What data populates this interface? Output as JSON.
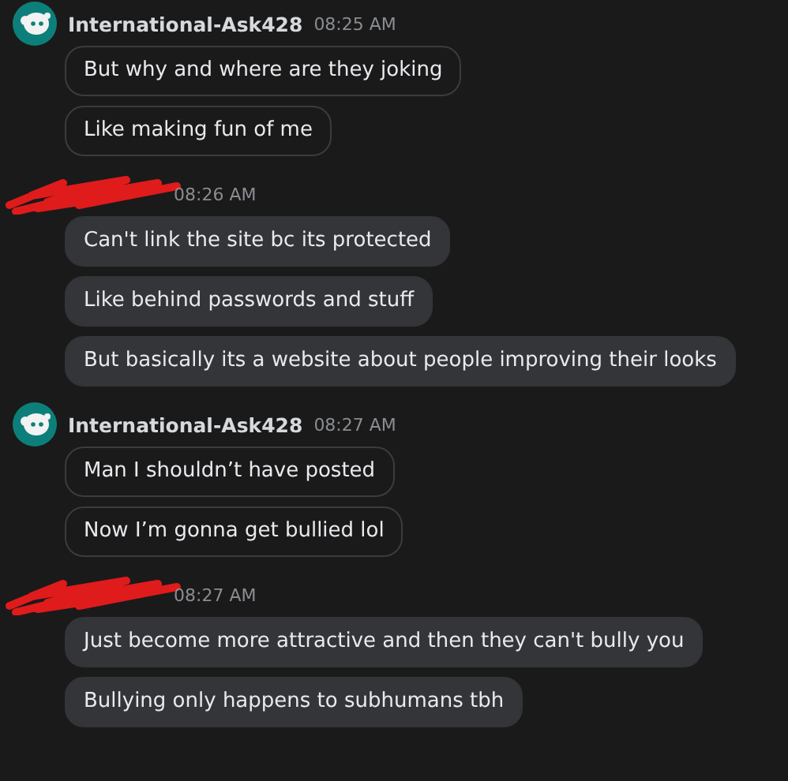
{
  "messages": [
    {
      "kind": "own",
      "author": "International-Ask428",
      "time": "08:25 AM",
      "lines": [
        "But why and where are they joking",
        "Like making fun of me"
      ]
    },
    {
      "kind": "redacted",
      "time": "08:26 AM",
      "lines": [
        "Can't link the site bc its protected",
        "Like behind passwords and stuff",
        "But basically its a website about people improving their looks"
      ]
    },
    {
      "kind": "own",
      "author": "International-Ask428",
      "time": "08:27 AM",
      "lines": [
        "Man I shouldn’t have posted",
        "Now I’m gonna get bullied lol"
      ]
    },
    {
      "kind": "redacted",
      "time": "08:27 AM",
      "lines": [
        "Just become more attractive and then they can't bully you",
        "Bullying only happens to subhumans tbh"
      ]
    }
  ]
}
